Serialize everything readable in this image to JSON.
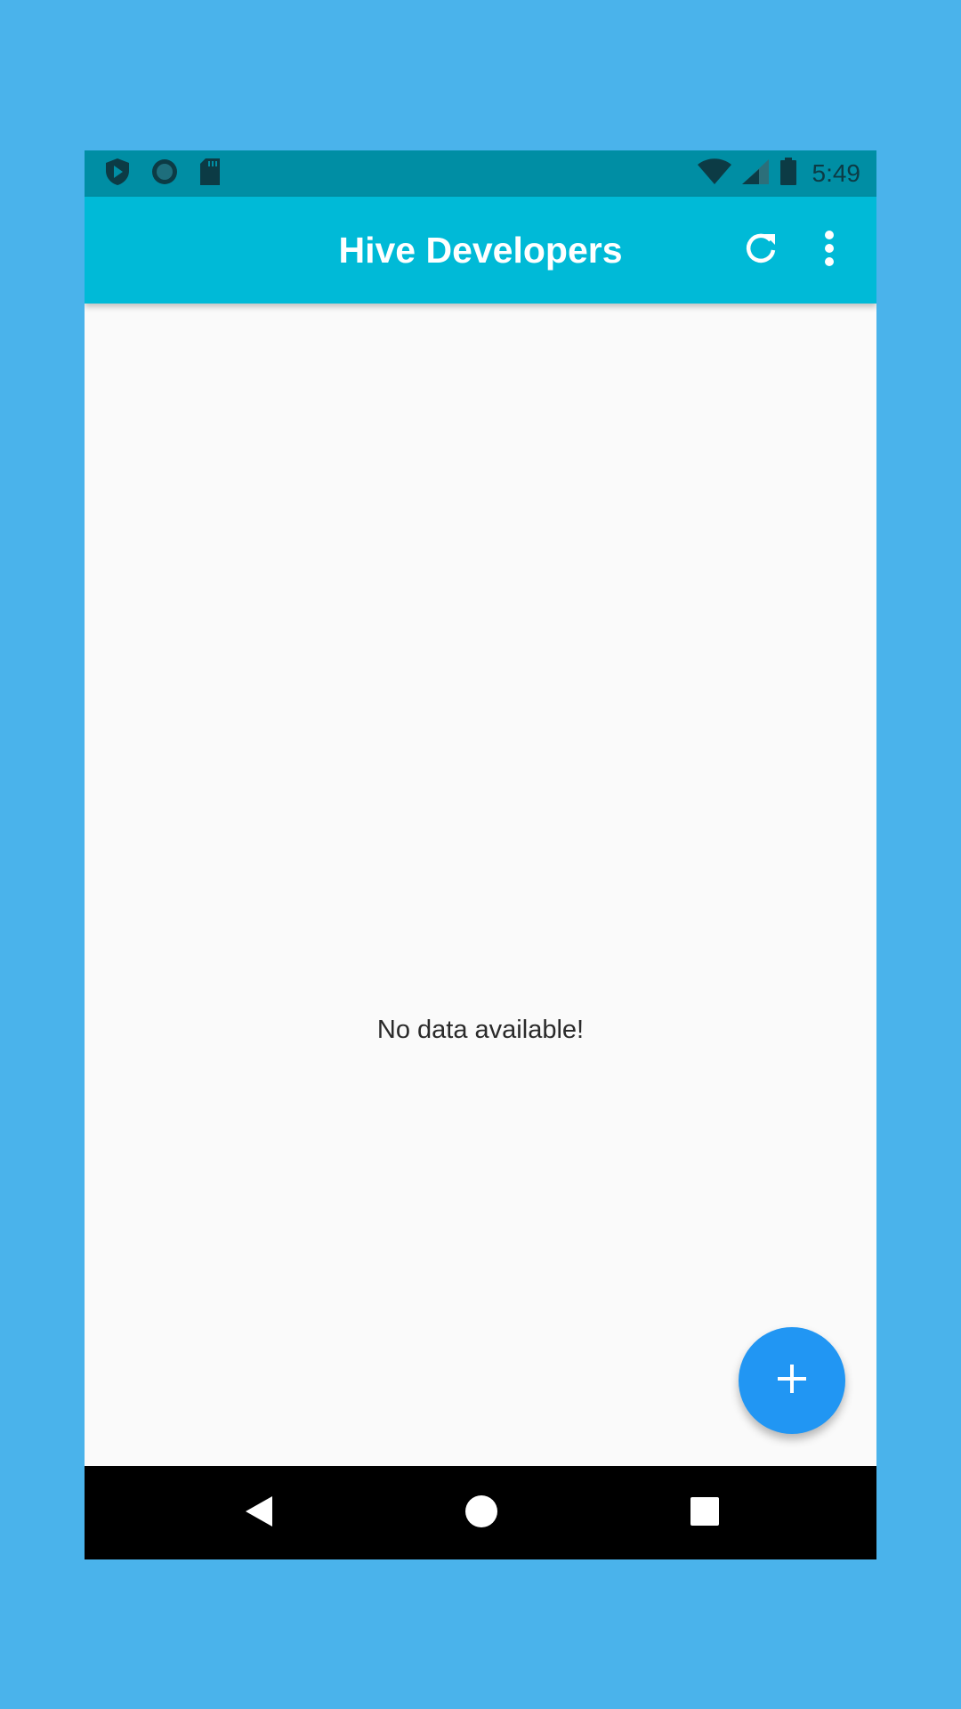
{
  "status_bar": {
    "time": "5:49",
    "icons": [
      "shield-play-icon",
      "circle-icon",
      "sd-card-icon",
      "wifi-icon",
      "signal-icon",
      "battery-icon"
    ]
  },
  "app_bar": {
    "title": "Hive Developers",
    "actions": [
      "refresh-icon",
      "more-vert-icon"
    ]
  },
  "content": {
    "empty_message": "No data available!"
  },
  "fab": {
    "icon": "plus-icon"
  },
  "nav_bar": {
    "buttons": [
      "back-icon",
      "home-icon",
      "recents-icon"
    ]
  },
  "colors": {
    "background": "#4AB3EB",
    "status_bar": "#008EA4",
    "app_bar": "#00BAD7",
    "fab": "#2196F3",
    "content": "#FAFAFA",
    "nav_bar": "#000000"
  }
}
